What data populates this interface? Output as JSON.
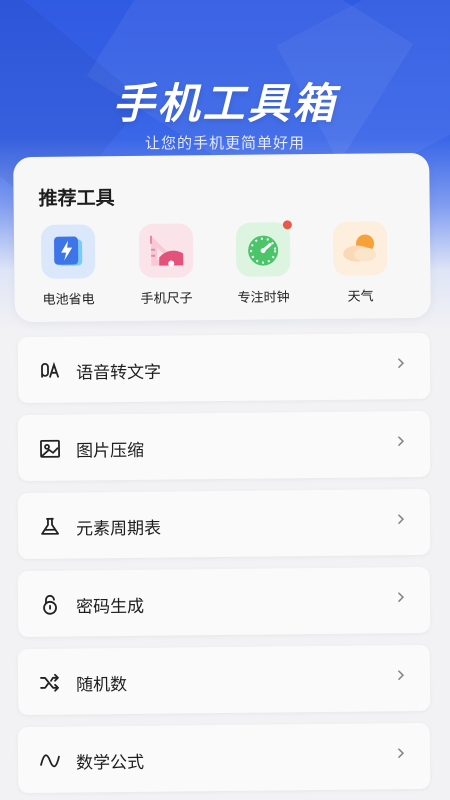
{
  "header": {
    "title": "手机工具箱",
    "subtitle": "让您的手机更简单好用"
  },
  "recommended": {
    "title": "推荐工具",
    "tools": [
      {
        "label": "电池省电",
        "icon": "battery-icon"
      },
      {
        "label": "手机尺子",
        "icon": "ruler-icon"
      },
      {
        "label": "专注时钟",
        "icon": "clock-icon",
        "badge": true
      },
      {
        "label": "天气",
        "icon": "weather-icon"
      }
    ]
  },
  "list": [
    {
      "label": "语音转文字",
      "icon": "speech-to-text-icon"
    },
    {
      "label": "图片压缩",
      "icon": "image-icon"
    },
    {
      "label": "元素周期表",
      "icon": "flask-icon"
    },
    {
      "label": "密码生成",
      "icon": "lock-icon"
    },
    {
      "label": "随机数",
      "icon": "shuffle-icon"
    },
    {
      "label": "数学公式",
      "icon": "formula-icon"
    }
  ],
  "colors": {
    "brand": "#3a66e8",
    "badge": "#e9584b"
  }
}
